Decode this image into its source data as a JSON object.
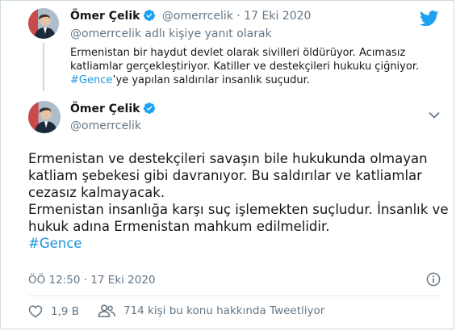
{
  "parent_tweet": {
    "author_name": "Ömer Çelik",
    "handle": "@omerrcelik",
    "separator": "·",
    "date": "17 Eki 2020",
    "reply_to": "@omerrcelik adlı kişiye yanıt olarak",
    "text_lines": [
      "Ermenistan bir haydut devlet olarak sivilleri öldürüyor. Acımasız",
      "katliamlar gerçekleştiriyor. Katiller ve destekçileri hukuku çiğniyor."
    ],
    "hashtag": "#Gence",
    "text_after_hashtag": "’ye yapılan saldırılar insanlık suçudur."
  },
  "main_tweet": {
    "author_name": "Ömer Çelik",
    "handle": "@omerrcelik",
    "text_lines": [
      "Ermenistan ve destekçileri savaşın bile hukukunda olmayan",
      "katliam şebekesi gibi davranıyor. Bu saldırılar ve katliamlar",
      "cezasız kalmayacak.",
      "Ermenistan insanlığa karşı suç işlemekten suçludur. İnsanlık ve",
      "hukuk adına Ermenistan mahkum edilmelidir."
    ],
    "hashtag": "#Gence",
    "timestamp": "ÖÖ 12:50 · 17 Eki 2020"
  },
  "actions": {
    "like_count": "1,9 B",
    "people_talking": "714 kişi bu konu hakkında Tweetliyor"
  },
  "colors": {
    "brand": "#1da1f2",
    "hashtag": "#1b95e0",
    "muted": "#657786"
  },
  "icons": [
    "verified-badge-icon",
    "twitter-bird-icon",
    "chevron-down-icon",
    "info-icon",
    "heart-icon",
    "people-icon"
  ]
}
